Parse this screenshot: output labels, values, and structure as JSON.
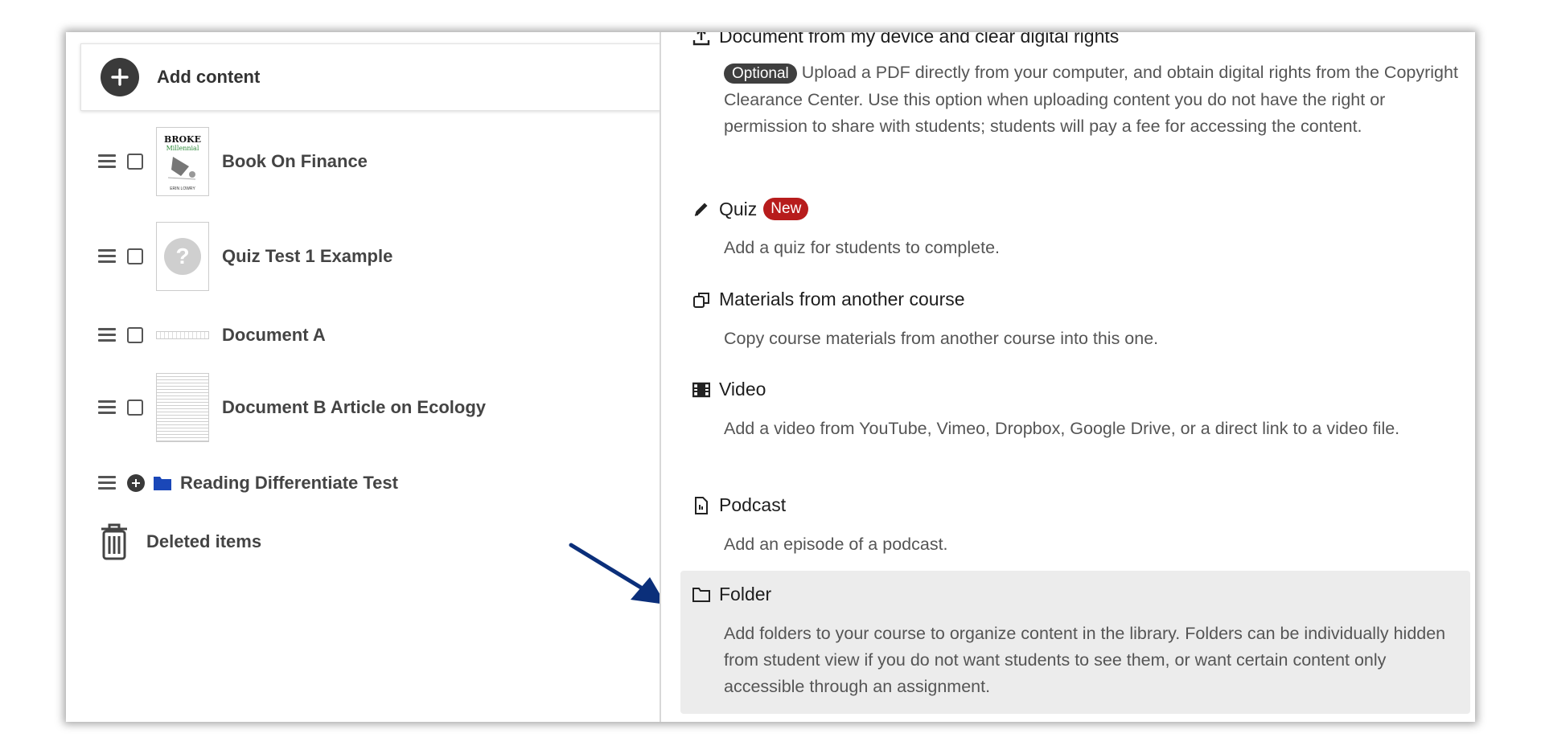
{
  "left_panel": {
    "add_content_label": "Add content",
    "items": [
      {
        "title": "Book On Finance",
        "thumb_text_1": "BROKE",
        "thumb_text_2": "Millennial",
        "thumb_text_3": "ERIN LOWRY"
      },
      {
        "title": "Quiz Test 1 Example",
        "thumb_glyph": "?"
      },
      {
        "title": "Document A"
      },
      {
        "title": "Document B Article on Ecology"
      }
    ],
    "folder": {
      "title": "Reading Differentiate Test"
    },
    "deleted": {
      "label": "Deleted items"
    }
  },
  "right_panel": {
    "options": [
      {
        "title": "Document from my device and clear digital rights",
        "badge": "Optional",
        "desc": "Upload a PDF directly from your computer, and obtain digital rights from the Copyright Clearance Center. Use this option when uploading content you do not have the right or permission to share with students; students will pay a fee for accessing the content."
      },
      {
        "title": "Quiz",
        "badge": "New",
        "desc": "Add a quiz for students to complete."
      },
      {
        "title": "Materials from another course",
        "desc": "Copy course materials from another course into this one."
      },
      {
        "title": "Video",
        "desc": "Add a video from YouTube, Vimeo, Dropbox, Google Drive, or a direct link to a video file."
      },
      {
        "title": "Podcast",
        "desc": "Add an episode of a podcast."
      },
      {
        "title": "Folder",
        "desc": "Add folders to your course to organize content in the library. Folders can be individually hidden from student view if you do not want students to see them, or want certain content only accessible through an assignment."
      }
    ]
  },
  "colors": {
    "badge_new": "#b71c1c",
    "badge_optional": "#3f3f3f",
    "folder_icon": "#1a47b8",
    "arrow": "#0b2f7a",
    "highlight": "#ececec"
  }
}
